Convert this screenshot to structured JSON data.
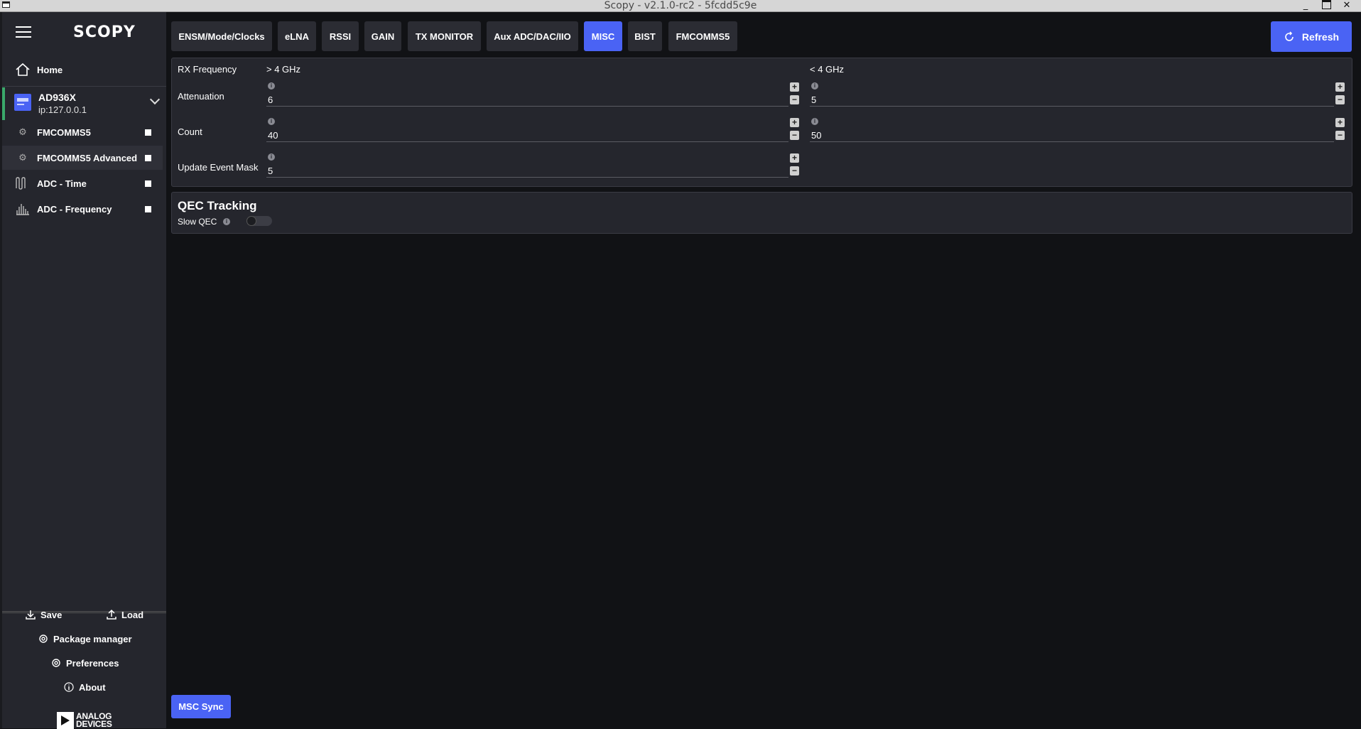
{
  "window": {
    "title": "Scopy - v2.1.0-rc2 - 5fcdd5c9e"
  },
  "sidebar": {
    "logo": "SCOPY",
    "home_label": "Home",
    "device": {
      "name": "AD936X",
      "ip": "ip:127.0.0.1"
    },
    "tools": [
      {
        "label": "FMCOMMS5",
        "icon": "gear-icon"
      },
      {
        "label": "FMCOMMS5 Advanced",
        "icon": "gear-icon"
      },
      {
        "label": "ADC - Time",
        "icon": "waveform-icon"
      },
      {
        "label": "ADC - Frequency",
        "icon": "spectrum-icon"
      }
    ],
    "bottom": {
      "save": "Save",
      "load": "Load",
      "package_manager": "Package manager",
      "preferences": "Preferences",
      "about": "About"
    },
    "brand": {
      "line1": "ANALOG",
      "line2": "DEVICES"
    }
  },
  "tabs": [
    {
      "label": "ENSM/Mode/Clocks",
      "active": false
    },
    {
      "label": "eLNA",
      "active": false
    },
    {
      "label": "RSSI",
      "active": false
    },
    {
      "label": "GAIN",
      "active": false
    },
    {
      "label": "TX MONITOR",
      "active": false
    },
    {
      "label": "Aux ADC/DAC/IIO",
      "active": false
    },
    {
      "label": "MISC",
      "active": true
    },
    {
      "label": "BIST",
      "active": false
    },
    {
      "label": "FMCOMMS5",
      "active": false
    }
  ],
  "refresh_label": "Refresh",
  "misc": {
    "rx_frequency_label": "RX Frequency",
    "high_label": "> 4 GHz",
    "low_label": "< 4 GHz",
    "attenuation_label": "Attenuation",
    "attenuation_high": "6",
    "attenuation_low": "5",
    "count_label": "Count",
    "count_high": "40",
    "count_low": "50",
    "update_event_mask_label": "Update Event Mask",
    "update_event_mask": "5"
  },
  "qec": {
    "title": "QEC Tracking",
    "slow_qec_label": "Slow QEC",
    "slow_qec_enabled": false
  },
  "msc_sync_label": "MSC Sync",
  "colors": {
    "accent": "#4a63f4",
    "connected": "#3aa96b",
    "background": "#111215",
    "panel": "#25262d"
  }
}
